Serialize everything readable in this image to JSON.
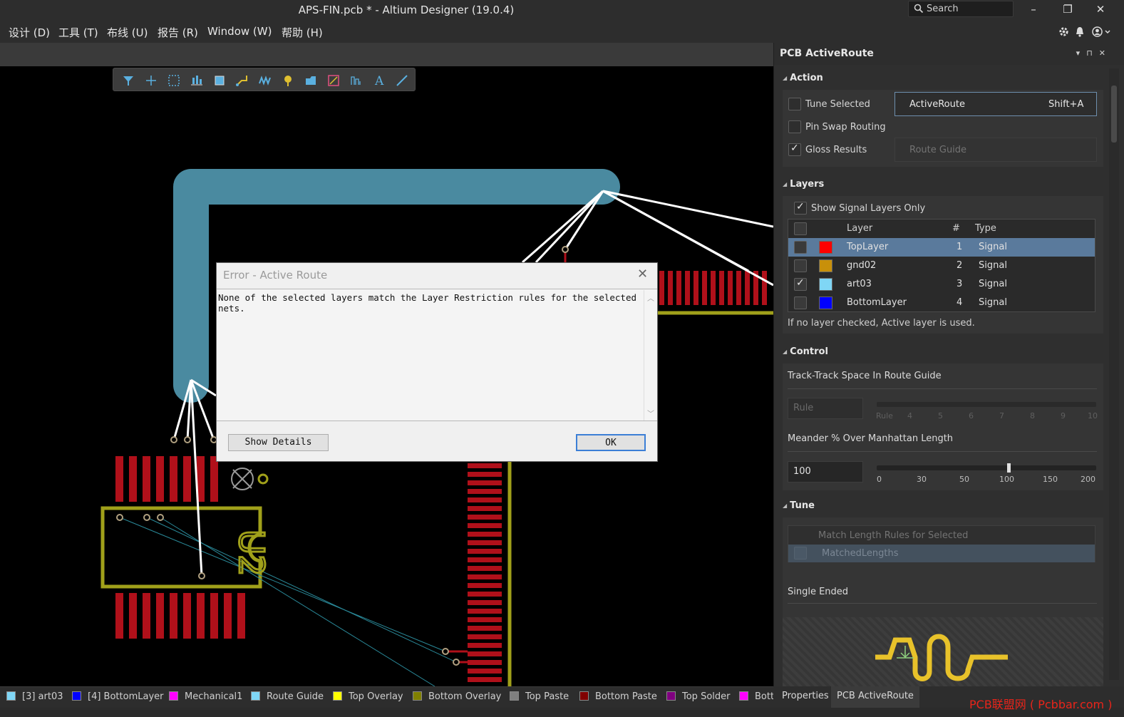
{
  "window": {
    "title": "APS-FIN.pcb * - Altium Designer (19.0.4)",
    "search_placeholder": "Search",
    "controls": {
      "minimize": "–",
      "restore": "❐",
      "close": "✕"
    }
  },
  "menu": {
    "items": [
      "设计 (D)",
      "工具 (T)",
      "布线 (U)",
      "报告 (R)",
      "Window (W)",
      "帮助 (H)"
    ],
    "right_icons": [
      "gear-icon",
      "bell-icon",
      "user-icon"
    ]
  },
  "toolbar": {
    "buttons": [
      "filter-icon",
      "crosshair-icon",
      "select-rect-icon",
      "align-icon",
      "component-icon",
      "route-icon",
      "interactive-route-icon",
      "pad-icon",
      "polygon-icon",
      "region-icon",
      "dimension-icon",
      "text-icon",
      "line-icon"
    ]
  },
  "canvas": {
    "designator": "U2"
  },
  "dialog": {
    "title": "Error - Active Route",
    "message": "None of the selected layers match the Layer Restriction rules for the selected nets.",
    "details_button": "Show Details",
    "ok_button": "OK"
  },
  "status_layers": [
    {
      "label": "[3] art03",
      "color": "#7fd6f5"
    },
    {
      "label": "[4] BottomLayer",
      "color": "#0000ff"
    },
    {
      "label": "Mechanical1",
      "color": "#ff00ff"
    },
    {
      "label": "Route Guide",
      "color": "#7fd6f5"
    },
    {
      "label": "Top Overlay",
      "color": "#ffff00"
    },
    {
      "label": "Bottom Overlay",
      "color": "#808000"
    },
    {
      "label": "Top Paste",
      "color": "#808080"
    },
    {
      "label": "Bottom Paste",
      "color": "#800000"
    },
    {
      "label": "Top Solder",
      "color": "#800080"
    },
    {
      "label": "Bott",
      "color": "#ff00ff"
    }
  ],
  "panel": {
    "title": "PCB ActiveRoute",
    "header_icons": [
      "▾",
      "⊓",
      "✕"
    ],
    "action": {
      "header": "Action",
      "tune_selected": {
        "label": "Tune Selected",
        "checked": false
      },
      "pin_swap_routing": {
        "label": "Pin Swap Routing",
        "checked": false
      },
      "gloss_results": {
        "label": "Gloss Results",
        "checked": true
      },
      "activeroute_button": "ActiveRoute",
      "activeroute_shortcut": "Shift+A",
      "route_guide_button": "Route Guide"
    },
    "layers": {
      "header": "Layers",
      "show_signal_only": {
        "label": "Show Signal Layers Only",
        "checked": true
      },
      "columns": {
        "layer": "Layer",
        "num": "#",
        "type": "Type"
      },
      "rows": [
        {
          "name": "TopLayer",
          "num": "1",
          "type": "Signal",
          "color": "#ff0000",
          "checked": false,
          "selected": true
        },
        {
          "name": "gnd02",
          "num": "2",
          "type": "Signal",
          "color": "#c8900a",
          "checked": false,
          "selected": false
        },
        {
          "name": "art03",
          "num": "3",
          "type": "Signal",
          "color": "#7fd6f5",
          "checked": true,
          "selected": false
        },
        {
          "name": "BottomLayer",
          "num": "4",
          "type": "Signal",
          "color": "#0000ff",
          "checked": false,
          "selected": false
        }
      ],
      "note": "If no layer checked, Active layer is used."
    },
    "control": {
      "header": "Control",
      "track_space_label": "Track-Track Space In Route Guide",
      "track_space_value": "Rule",
      "track_space_ticks": [
        "Rule",
        "4",
        "5",
        "6",
        "7",
        "8",
        "9",
        "10"
      ],
      "meander_label": "Meander % Over Manhattan Length",
      "meander_value": "100",
      "meander_ticks": [
        "0",
        "30",
        "50",
        "100",
        "150",
        "200"
      ]
    },
    "tune": {
      "header": "Tune",
      "match_length_label": "Match Length Rules for Selected",
      "matched_lengths": "MatchedLengths",
      "single_ended": "Single Ended"
    }
  },
  "bottom_tabs": [
    "Properties",
    "PCB ActiveRoute"
  ],
  "watermark": "PCB联盟网 ( Pcbbar.com )"
}
